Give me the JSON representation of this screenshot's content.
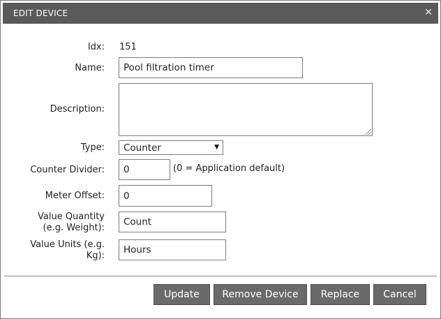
{
  "dialog": {
    "title": "EDIT DEVICE",
    "close_icon": "close-icon"
  },
  "form": {
    "idx_label": "Idx:",
    "idx_value": "151",
    "name_label": "Name:",
    "name_value": "Pool filtration timer",
    "description_label": "Description:",
    "description_value": "",
    "type_label": "Type:",
    "type_value": "Counter",
    "counter_divider_label": "Counter Divider:",
    "counter_divider_value": "0",
    "counter_divider_hint": "(0 = Application default)",
    "meter_offset_label": "Meter Offset:",
    "meter_offset_value": "0",
    "value_quantity_label_line1": "Value Quantity",
    "value_quantity_label_line2": "(e.g. Weight):",
    "value_quantity_value": "Count",
    "value_units_label_line1": "Value Units (e.g.",
    "value_units_label_line2": "Kg):",
    "value_units_value": "Hours"
  },
  "buttons": {
    "update": "Update",
    "remove": "Remove Device",
    "replace": "Replace",
    "cancel": "Cancel"
  },
  "colors": {
    "titlebar": "#5a5a5a",
    "button": "#6a6a6a"
  }
}
